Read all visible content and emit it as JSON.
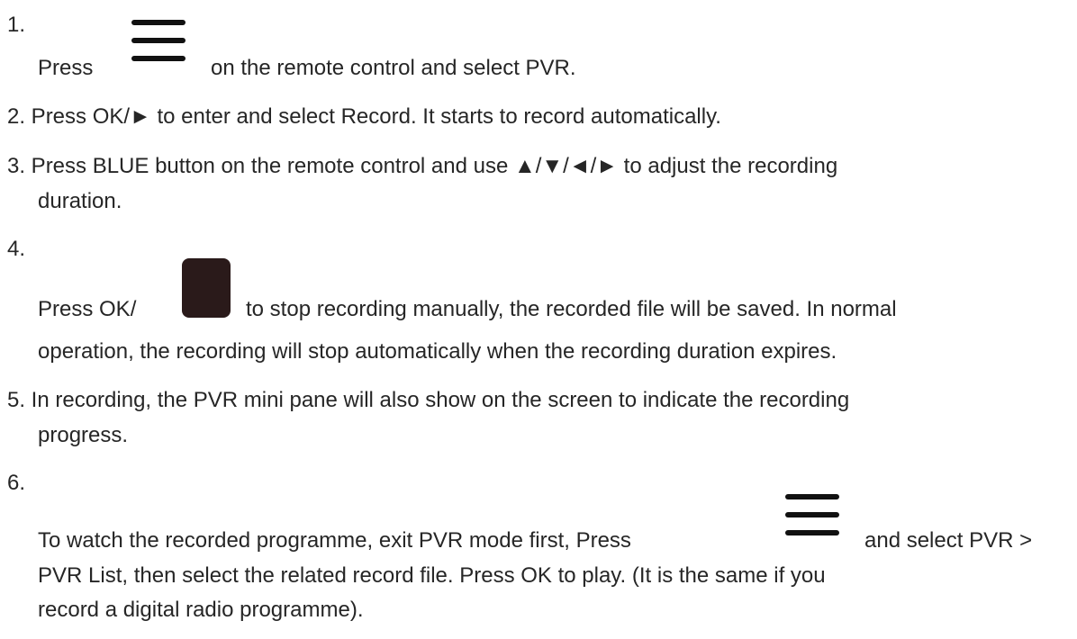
{
  "steps": [
    {
      "number": "1.",
      "text_before_icon": "Press",
      "icon": "menu-icon",
      "text_after_icon": "on the remote control and select PVR."
    },
    {
      "number": "",
      "text": "2. Press OK/► to enter and select Record. It starts to record automatically."
    },
    {
      "number": "",
      "line1": "3. Press BLUE button on the remote control and use ▲/▼/◄/► to adjust the recording",
      "line2": "duration."
    },
    {
      "number": "4.",
      "text_before_icon": "Press OK/",
      "icon": "stop-icon",
      "text_after_icon": "to stop recording manually, the recorded file will be saved. In normal",
      "line2": "operation, the recording will stop automatically when the recording duration expires."
    },
    {
      "number": "",
      "line1": "5. In recording, the PVR mini pane will also show on the screen to indicate the recording",
      "line2": "progress."
    },
    {
      "number": "6.",
      "text_before_icon": "To watch the recorded programme, exit PVR mode first, Press",
      "icon": "menu-icon",
      "text_after_icon": "and select PVR >",
      "line2": "PVR List, then select the related record file. Press OK to play. (It is the same if you",
      "line3": "record a digital radio programme)."
    }
  ]
}
